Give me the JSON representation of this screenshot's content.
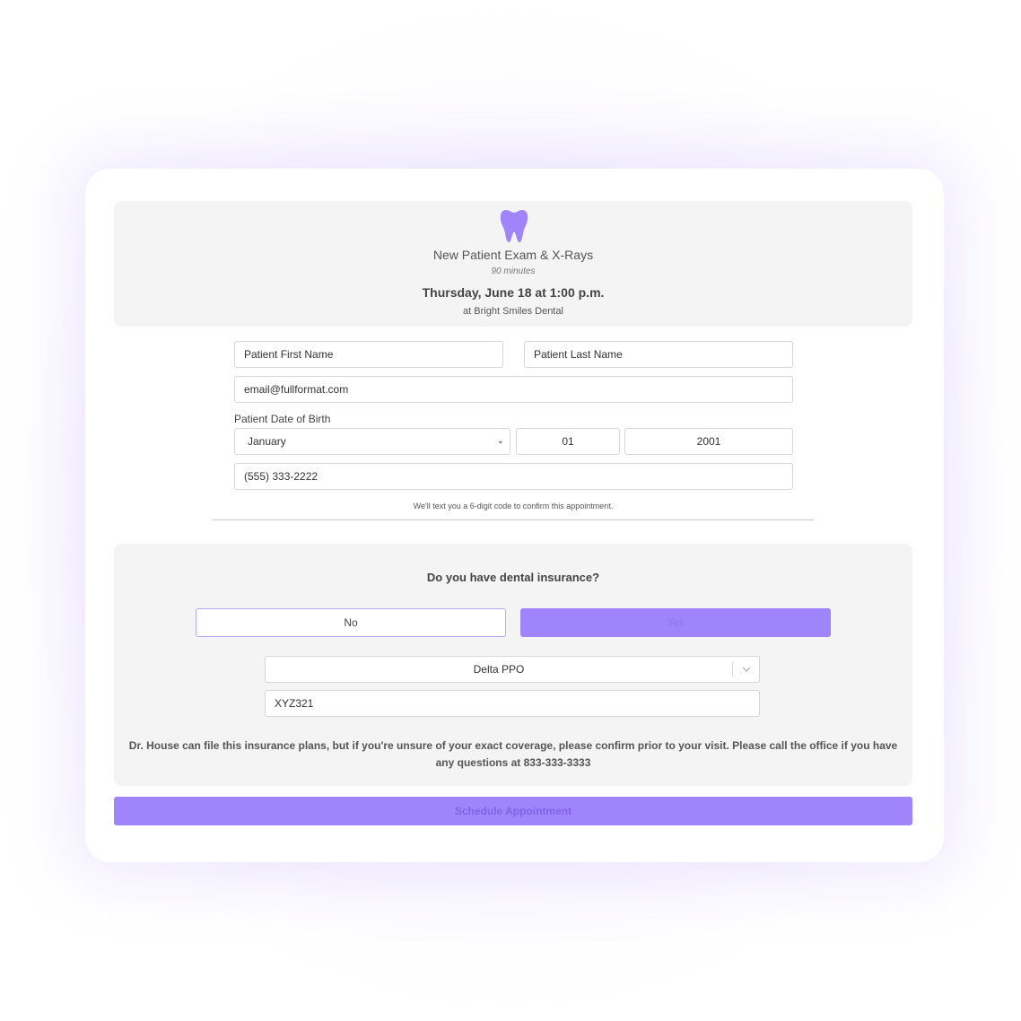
{
  "appointment": {
    "service": "New Patient Exam & X-Rays",
    "duration": "90 minutes",
    "datetime": "Thursday, June 18 at 1:00 p.m.",
    "location": "at Bright Smiles Dental",
    "icon": "tooth-icon"
  },
  "form": {
    "first_name_placeholder": "Patient First Name",
    "last_name_placeholder": "Patient Last Name",
    "email_value": "email@fullformat.com",
    "dob_label": "Patient Date of Birth",
    "dob_month": "January",
    "dob_day": "01",
    "dob_year": "2001",
    "phone_value": "(555) 333-2222",
    "help_text": "We'll text you a 6-digit code to confirm this appointment."
  },
  "insurance": {
    "question": "Do you have dental insurance?",
    "no_label": "No",
    "yes_label": "Yes",
    "plan_value": "Delta PPO",
    "member_id_value": "XYZ321",
    "note": "Dr. House can file this insurance plans, but if you're unsure of your exact coverage, please confirm prior to your visit. Please call the office if you have any questions at 833-333-3333"
  },
  "submit_label": "Schedule Appointment",
  "colors": {
    "accent": "#a084fc",
    "panel": "#f4f4f4",
    "border": "#d6d6d6"
  }
}
